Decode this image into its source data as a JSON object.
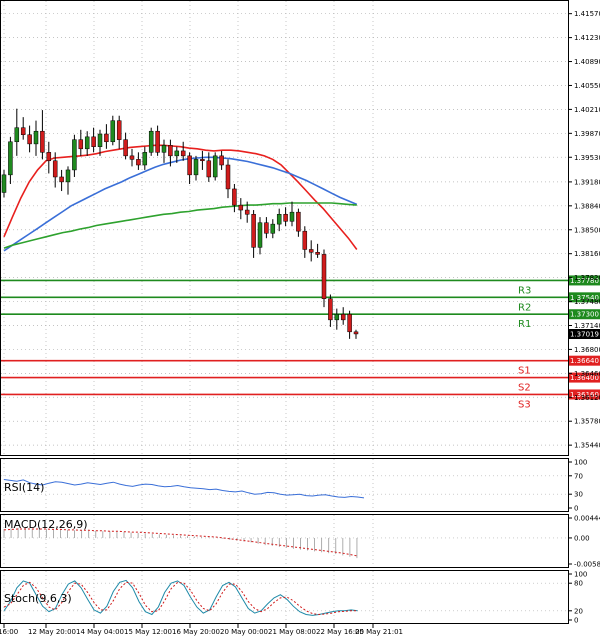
{
  "chart_data": {
    "type": "candlestick",
    "instrument_type": "forex",
    "price_axis": {
      "ticks": [
        "1.41570",
        "1.41230",
        "1.40890",
        "1.40550",
        "1.40210",
        "1.39870",
        "1.39530",
        "1.39180",
        "1.38840",
        "1.38500",
        "1.38160",
        "1.37820",
        "1.37480",
        "1.37140",
        "1.36800",
        "1.36460",
        "1.36120",
        "1.35780",
        "1.35440"
      ],
      "ylim": [
        1.353,
        1.4175
      ]
    },
    "time_axis": {
      "labels": [
        "16:00",
        "12 May 20:00",
        "14 May 04:00",
        "15 May 12:00",
        "16 May 20:00",
        "20 May 00:00",
        "21 May 08:00",
        "22 May 16:00",
        "25 May 21:01"
      ]
    },
    "candles": [
      {
        "o": 1.3903,
        "h": 1.3935,
        "l": 1.3896,
        "c": 1.3928
      },
      {
        "o": 1.3928,
        "h": 1.3982,
        "l": 1.3915,
        "c": 1.3975
      },
      {
        "o": 1.3975,
        "h": 1.4022,
        "l": 1.3955,
        "c": 1.3995
      },
      {
        "o": 1.3995,
        "h": 1.401,
        "l": 1.3978,
        "c": 1.3985
      },
      {
        "o": 1.3985,
        "h": 1.3998,
        "l": 1.396,
        "c": 1.3972
      },
      {
        "o": 1.3972,
        "h": 1.4005,
        "l": 1.3955,
        "c": 1.399
      },
      {
        "o": 1.399,
        "h": 1.402,
        "l": 1.395,
        "c": 1.396
      },
      {
        "o": 1.396,
        "h": 1.3975,
        "l": 1.393,
        "c": 1.3948
      },
      {
        "o": 1.3948,
        "h": 1.396,
        "l": 1.391,
        "c": 1.3925
      },
      {
        "o": 1.3925,
        "h": 1.3935,
        "l": 1.3905,
        "c": 1.3918
      },
      {
        "o": 1.3918,
        "h": 1.394,
        "l": 1.39,
        "c": 1.3935
      },
      {
        "o": 1.3935,
        "h": 1.3985,
        "l": 1.3925,
        "c": 1.3978
      },
      {
        "o": 1.3978,
        "h": 1.3992,
        "l": 1.3955,
        "c": 1.3965
      },
      {
        "o": 1.3965,
        "h": 1.399,
        "l": 1.3955,
        "c": 1.3982
      },
      {
        "o": 1.3982,
        "h": 1.3995,
        "l": 1.396,
        "c": 1.3968
      },
      {
        "o": 1.3968,
        "h": 1.3992,
        "l": 1.3955,
        "c": 1.3986
      },
      {
        "o": 1.3986,
        "h": 1.4,
        "l": 1.3965,
        "c": 1.3975
      },
      {
        "o": 1.3975,
        "h": 1.4012,
        "l": 1.397,
        "c": 1.4005
      },
      {
        "o": 1.4005,
        "h": 1.4012,
        "l": 1.3965,
        "c": 1.3978
      },
      {
        "o": 1.3978,
        "h": 1.3988,
        "l": 1.395,
        "c": 1.3955
      },
      {
        "o": 1.3955,
        "h": 1.3965,
        "l": 1.394,
        "c": 1.395
      },
      {
        "o": 1.395,
        "h": 1.396,
        "l": 1.3935,
        "c": 1.3942
      },
      {
        "o": 1.3942,
        "h": 1.3968,
        "l": 1.3935,
        "c": 1.396
      },
      {
        "o": 1.396,
        "h": 1.3995,
        "l": 1.3955,
        "c": 1.399
      },
      {
        "o": 1.399,
        "h": 1.3998,
        "l": 1.3955,
        "c": 1.396
      },
      {
        "o": 1.396,
        "h": 1.3978,
        "l": 1.3945,
        "c": 1.397
      },
      {
        "o": 1.397,
        "h": 1.3978,
        "l": 1.394,
        "c": 1.3955
      },
      {
        "o": 1.3955,
        "h": 1.3968,
        "l": 1.3945,
        "c": 1.3962
      },
      {
        "o": 1.3962,
        "h": 1.3975,
        "l": 1.3948,
        "c": 1.3955
      },
      {
        "o": 1.3955,
        "h": 1.396,
        "l": 1.3915,
        "c": 1.3928
      },
      {
        "o": 1.3928,
        "h": 1.3955,
        "l": 1.392,
        "c": 1.395
      },
      {
        "o": 1.395,
        "h": 1.3962,
        "l": 1.3935,
        "c": 1.3948
      },
      {
        "o": 1.3948,
        "h": 1.396,
        "l": 1.3918,
        "c": 1.3925
      },
      {
        "o": 1.3925,
        "h": 1.396,
        "l": 1.392,
        "c": 1.3955
      },
      {
        "o": 1.3955,
        "h": 1.3962,
        "l": 1.3935,
        "c": 1.3942
      },
      {
        "o": 1.3942,
        "h": 1.395,
        "l": 1.3895,
        "c": 1.3908
      },
      {
        "o": 1.3908,
        "h": 1.3915,
        "l": 1.3875,
        "c": 1.3885
      },
      {
        "o": 1.3885,
        "h": 1.3895,
        "l": 1.3865,
        "c": 1.3878
      },
      {
        "o": 1.3878,
        "h": 1.389,
        "l": 1.386,
        "c": 1.3872
      },
      {
        "o": 1.3872,
        "h": 1.3878,
        "l": 1.381,
        "c": 1.3825
      },
      {
        "o": 1.3825,
        "h": 1.3868,
        "l": 1.3815,
        "c": 1.386
      },
      {
        "o": 1.386,
        "h": 1.3868,
        "l": 1.3838,
        "c": 1.3845
      },
      {
        "o": 1.3845,
        "h": 1.3865,
        "l": 1.3838,
        "c": 1.3858
      },
      {
        "o": 1.3858,
        "h": 1.388,
        "l": 1.3848,
        "c": 1.3872
      },
      {
        "o": 1.3872,
        "h": 1.3882,
        "l": 1.3855,
        "c": 1.3862
      },
      {
        "o": 1.3862,
        "h": 1.389,
        "l": 1.3855,
        "c": 1.3875
      },
      {
        "o": 1.3875,
        "h": 1.388,
        "l": 1.384,
        "c": 1.3848
      },
      {
        "o": 1.3848,
        "h": 1.3855,
        "l": 1.381,
        "c": 1.3822
      },
      {
        "o": 1.3822,
        "h": 1.3835,
        "l": 1.3805,
        "c": 1.3818
      },
      {
        "o": 1.3818,
        "h": 1.383,
        "l": 1.381,
        "c": 1.3815
      },
      {
        "o": 1.3815,
        "h": 1.3822,
        "l": 1.374,
        "c": 1.3752
      },
      {
        "o": 1.3752,
        "h": 1.3758,
        "l": 1.3712,
        "c": 1.3722
      },
      {
        "o": 1.3722,
        "h": 1.3738,
        "l": 1.3708,
        "c": 1.373
      },
      {
        "o": 1.373,
        "h": 1.374,
        "l": 1.3715,
        "c": 1.3722
      },
      {
        "o": 1.373,
        "h": 1.3735,
        "l": 1.3695,
        "c": 1.3705
      },
      {
        "o": 1.3705,
        "h": 1.3708,
        "l": 1.3695,
        "c": 1.3702
      }
    ],
    "moving_averages": [
      {
        "name": "",
        "color": "#e8201e",
        "values": [
          1.384,
          1.3868,
          1.3895,
          1.3918,
          1.3935,
          1.3948,
          1.3952,
          1.3953,
          1.3954,
          1.3955,
          1.3956,
          1.3958,
          1.3961,
          1.3963,
          1.3965,
          1.3967,
          1.3968,
          1.3969,
          1.397,
          1.397,
          1.3969,
          1.3968,
          1.3966,
          1.3965,
          1.3963,
          1.3962,
          1.3963,
          1.3963,
          1.3962,
          1.396,
          1.3958,
          1.3955,
          1.395,
          1.3942,
          1.393,
          1.3918,
          1.3905,
          1.3892,
          1.388,
          1.3866,
          1.3852,
          1.3838,
          1.3822
        ]
      },
      {
        "name": "",
        "color": "#3a6fd8",
        "values": [
          1.382,
          1.3828,
          1.3836,
          1.3844,
          1.3852,
          1.386,
          1.3868,
          1.3876,
          1.3884,
          1.389,
          1.3896,
          1.3902,
          1.3908,
          1.3913,
          1.3918,
          1.3924,
          1.3929,
          1.3934,
          1.3939,
          1.3943,
          1.3946,
          1.3949,
          1.3951,
          1.3952,
          1.3953,
          1.3953,
          1.3952,
          1.3951,
          1.3949,
          1.3947,
          1.3944,
          1.3941,
          1.3938,
          1.3934,
          1.393,
          1.3925,
          1.392,
          1.3914,
          1.3908,
          1.3902,
          1.3896,
          1.3891,
          1.3886
        ]
      },
      {
        "name": "",
        "color": "#2ea22e",
        "values": [
          1.3824,
          1.3828,
          1.3831,
          1.3834,
          1.3837,
          1.384,
          1.3843,
          1.3846,
          1.3848,
          1.3851,
          1.3853,
          1.3856,
          1.3858,
          1.386,
          1.3862,
          1.3864,
          1.3866,
          1.3868,
          1.387,
          1.3872,
          1.3873,
          1.3875,
          1.3876,
          1.3878,
          1.3879,
          1.388,
          1.3882,
          1.3883,
          1.3884,
          1.3885,
          1.3885,
          1.3886,
          1.3887,
          1.3887,
          1.3888,
          1.3888,
          1.3888,
          1.3888,
          1.3888,
          1.3888,
          1.3887,
          1.3886,
          1.3885
        ]
      }
    ],
    "levels": [
      {
        "label": "R3",
        "price_label": "1.37780",
        "value": 1.3778,
        "color": "#1e8a1e"
      },
      {
        "label": "R2",
        "price_label": "1.37540",
        "value": 1.3754,
        "color": "#1e8a1e"
      },
      {
        "label": "R1",
        "price_label": "1.37300",
        "value": 1.373,
        "color": "#1e8a1e"
      },
      {
        "label": "S1",
        "price_label": "1.36640",
        "value": 1.3664,
        "color": "#e02020"
      },
      {
        "label": "S2",
        "price_label": "1.36400",
        "value": 1.364,
        "color": "#e02020"
      },
      {
        "label": "S3",
        "price_label": "1.36160",
        "value": 1.3616,
        "color": "#e02020"
      }
    ],
    "current_price": {
      "label": "1.37019",
      "value": 1.37019
    },
    "indicators": [
      {
        "name": "RSI(14)",
        "ticks": [
          "100",
          "70",
          "30",
          "0"
        ],
        "ylim": [
          0,
          100
        ],
        "values": [
          62,
          60,
          58,
          61,
          55,
          52,
          50,
          54,
          57,
          56,
          53,
          50,
          52,
          55,
          53,
          51,
          54,
          56,
          52,
          49,
          47,
          50,
          52,
          51,
          48,
          46,
          47,
          49,
          46,
          44,
          43,
          42,
          40,
          41,
          38,
          36,
          35,
          37,
          33,
          30,
          31,
          34,
          33,
          30,
          28,
          29,
          30,
          27,
          26,
          28,
          29,
          26,
          24,
          23,
          25,
          24,
          22
        ]
      },
      {
        "name": "MACD(12,26,9)",
        "ticks": [
          "0.004444",
          "0.00",
          "-0.005809"
        ],
        "ylim": [
          -0.005809,
          0.004444
        ],
        "histogram": [
          0.002,
          0.0021,
          0.0022,
          0.0022,
          0.0021,
          0.0021,
          0.002,
          0.0019,
          0.0019,
          0.0018,
          0.0017,
          0.0017,
          0.0016,
          0.0016,
          0.0015,
          0.0015,
          0.0014,
          0.0013,
          0.0012,
          0.0011,
          0.001,
          0.0009,
          0.0008,
          0.0007,
          0.0006,
          0.0005,
          0.0004,
          0.0003,
          0.0002,
          0.0001,
          0.0,
          -0.0002,
          -0.0004,
          -0.0006,
          -0.0008,
          -0.001,
          -0.0013,
          -0.0016,
          -0.0018,
          -0.002,
          -0.0022,
          -0.0024,
          -0.0026,
          -0.0028,
          -0.003,
          -0.0032,
          -0.0034,
          -0.0036,
          -0.0039,
          -0.0042,
          -0.0045
        ],
        "signal": [
          0.0018,
          0.0019,
          0.002,
          0.002,
          0.002,
          0.002,
          0.002,
          0.0019,
          0.0019,
          0.0018,
          0.0018,
          0.0017,
          0.0017,
          0.0016,
          0.0016,
          0.0015,
          0.0015,
          0.0014,
          0.0013,
          0.0013,
          0.0012,
          0.0011,
          0.001,
          0.0009,
          0.0008,
          0.0007,
          0.0006,
          0.0005,
          0.0004,
          0.0003,
          0.0002,
          0.0,
          -0.0002,
          -0.0004,
          -0.0006,
          -0.0008,
          -0.001,
          -0.0012,
          -0.0014,
          -0.0016,
          -0.0018,
          -0.002,
          -0.0022,
          -0.0024,
          -0.0026,
          -0.0028,
          -0.003,
          -0.0032,
          -0.0034,
          -0.0037,
          -0.004
        ]
      },
      {
        "name": "Stoch(9,6,3)",
        "ticks": [
          "100",
          "80",
          "20",
          "0"
        ],
        "ylim": [
          0,
          100
        ],
        "k": [
          20,
          40,
          70,
          85,
          80,
          55,
          30,
          18,
          25,
          55,
          78,
          85,
          70,
          45,
          22,
          15,
          30,
          62,
          82,
          86,
          70,
          40,
          18,
          12,
          28,
          60,
          80,
          85,
          75,
          50,
          28,
          15,
          22,
          50,
          75,
          82,
          72,
          48,
          25,
          15,
          20,
          35,
          48,
          55,
          45,
          30,
          18,
          12,
          10,
          12,
          15,
          18,
          20,
          20,
          22,
          20
        ],
        "d": [
          28,
          35,
          55,
          75,
          82,
          70,
          48,
          28,
          22,
          38,
          62,
          80,
          78,
          60,
          38,
          22,
          22,
          42,
          68,
          82,
          80,
          58,
          32,
          18,
          20,
          42,
          68,
          82,
          80,
          65,
          42,
          25,
          20,
          35,
          60,
          78,
          78,
          62,
          40,
          25,
          18,
          25,
          38,
          48,
          50,
          42,
          30,
          20,
          14,
          12,
          13,
          15,
          18,
          19,
          20,
          20
        ]
      }
    ]
  }
}
